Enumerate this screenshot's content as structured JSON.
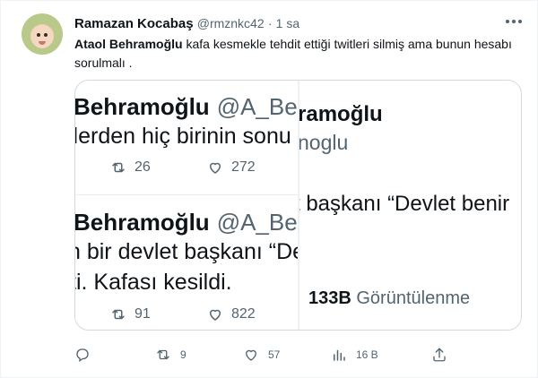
{
  "tweet": {
    "display_name": "Ramazan Kocabaş",
    "handle": "@rmznkc42",
    "separator": "·",
    "time": "1 sa",
    "mention": "Ataol Behramoğlu",
    "text_rest": " kafa kesmekle tehdit ettiği twitleri silmiş ama bunun hesabı sorulmalı ."
  },
  "media": {
    "top_left": {
      "name": "Behramoğlu",
      "handle": "@A_Behra",
      "line": "ilerden hiç birinin sonu",
      "retweets": "26",
      "likes": "272"
    },
    "bottom_left": {
      "name": "Behramoğlu",
      "handle": "@A_Behra",
      "line1": "n bir devlet başkanı “De",
      "line2": "ti. Kafası kesildi.",
      "retweets": "91",
      "likes": "822"
    },
    "right": {
      "name": "ramoğlu",
      "handle": "noglu",
      "line": "t başkanı “Devlet benir",
      "views_count": "133B",
      "views_label": "Görüntülenme"
    }
  },
  "actions": {
    "replies": "",
    "retweets": "9",
    "likes": "57",
    "views": "16 B"
  },
  "icons": [
    "more-icon",
    "reply-icon",
    "retweet-icon",
    "like-icon",
    "views-icon",
    "share-icon"
  ],
  "colors": {
    "text": "#0f1419",
    "secondary": "#536471",
    "border": "#cfd9de"
  }
}
